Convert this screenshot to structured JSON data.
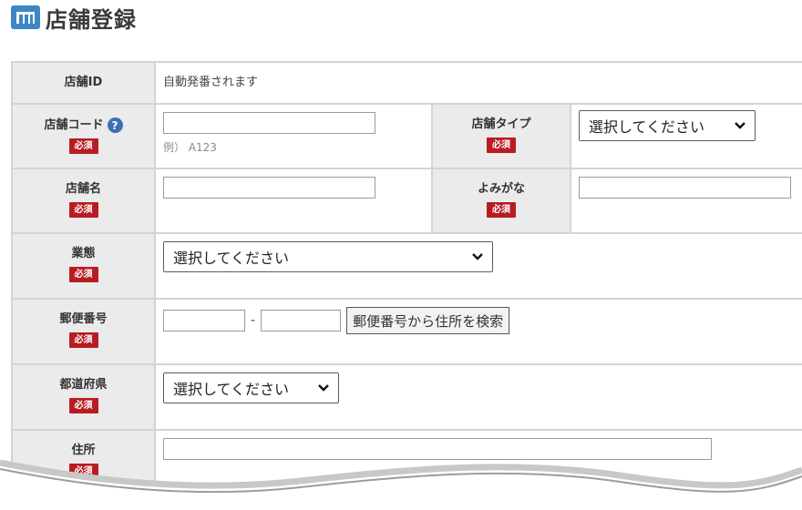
{
  "header": {
    "title": "店舗登録"
  },
  "form": {
    "required_label": "必須",
    "store_id": {
      "label": "店舗ID",
      "value": "自動発番されます"
    },
    "store_code": {
      "label": "店舗コード",
      "help": "?",
      "value": "",
      "hint": "例） A123"
    },
    "store_type": {
      "label": "店舗タイプ",
      "select_value": "選択してください"
    },
    "store_name": {
      "label": "店舗名",
      "value": ""
    },
    "yomigana": {
      "label": "よみがな",
      "value": ""
    },
    "business_type": {
      "label": "業態",
      "select_value": "選択してください"
    },
    "postal_code": {
      "label": "郵便番号",
      "part1": "",
      "part2": "",
      "dash": "-",
      "search_button": "郵便番号から住所を検索"
    },
    "prefecture": {
      "label": "都道府県",
      "select_value": "選択してください"
    },
    "address": {
      "label": "住所",
      "value": ""
    }
  }
}
